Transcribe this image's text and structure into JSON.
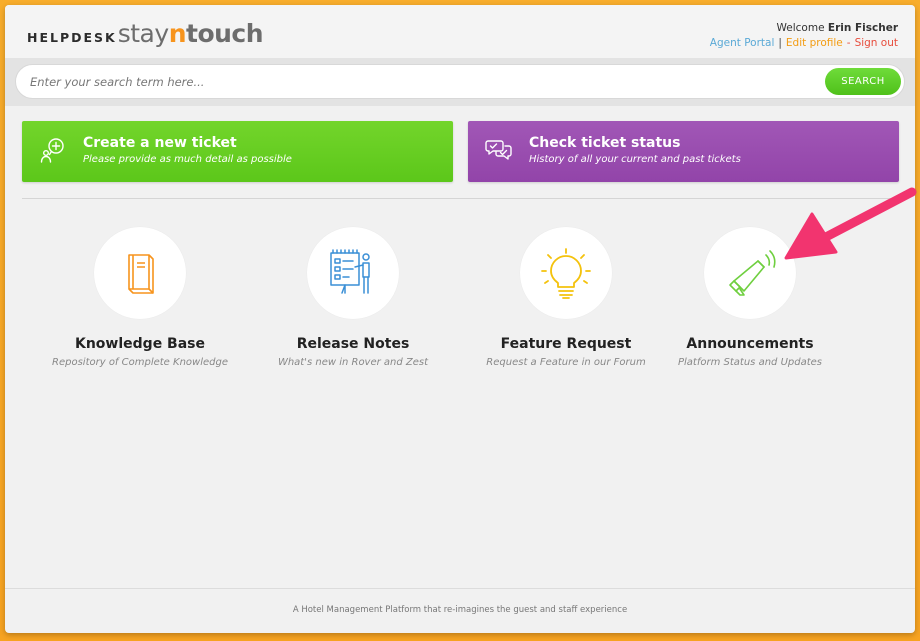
{
  "header": {
    "logo": {
      "helpdesk": "HELPDESK",
      "stay": "stay",
      "n": "n",
      "touch": "touch"
    },
    "welcome_prefix": "Welcome",
    "user_name": "Erin Fischer",
    "links": {
      "agent_portal": "Agent Portal",
      "edit_profile": "Edit profile",
      "sign_out": "Sign out"
    }
  },
  "search": {
    "placeholder": "Enter your search term here...",
    "button_label": "SEARCH"
  },
  "actions": [
    {
      "title": "Create a new ticket",
      "subtitle": "Please provide as much detail as possible",
      "color": "#63cb1f",
      "icon": "speech-bubble-plus-icon"
    },
    {
      "title": "Check ticket status",
      "subtitle": "History of all your current and past tickets",
      "color": "#9b4db0",
      "icon": "speech-bubbles-check-icon"
    }
  ],
  "features": [
    {
      "title": "Knowledge Base",
      "subtitle": "Repository of Complete Knowledge",
      "icon": "book-icon",
      "color": "#f7941d"
    },
    {
      "title": "Release Notes",
      "subtitle": "What's new in Rover and Zest",
      "icon": "presentation-board-icon",
      "color": "#3a8fd6"
    },
    {
      "title": "Feature Request",
      "subtitle": "Request a Feature in our Forum",
      "icon": "lightbulb-icon",
      "color": "#f4c20d"
    },
    {
      "title": "Announcements",
      "subtitle": "Platform Status and Updates",
      "icon": "megaphone-icon",
      "color": "#6fcf3f"
    }
  ],
  "footer": {
    "text": "A Hotel Management Platform that re-imagines the guest and staff experience"
  },
  "annotation": {
    "icon": "arrow-icon",
    "color": "#f2346f"
  }
}
